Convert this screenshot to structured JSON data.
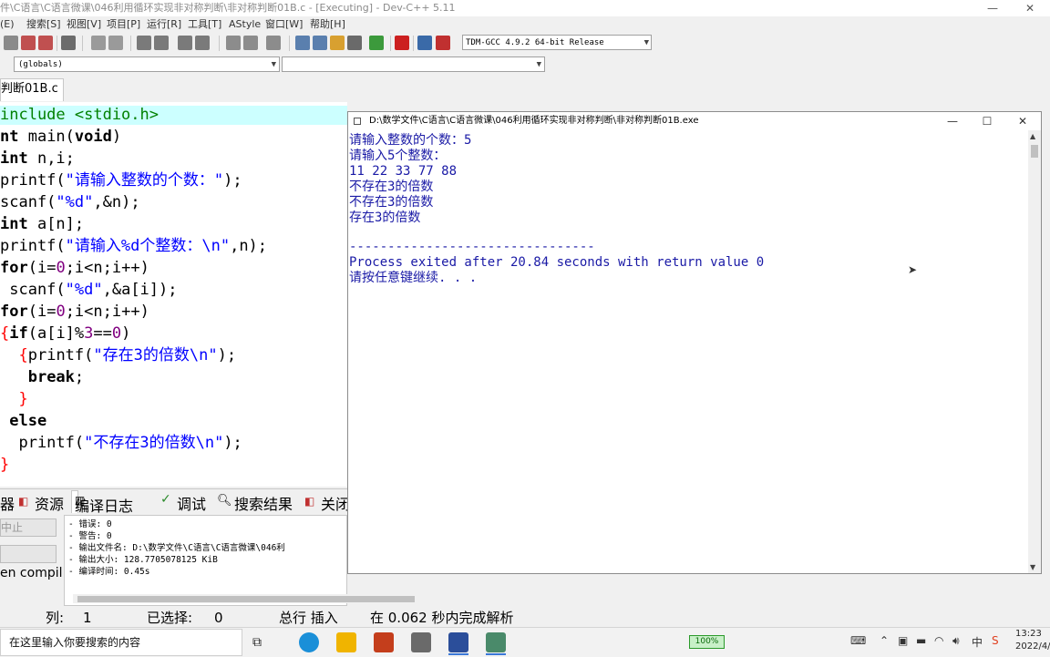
{
  "window": {
    "title": "件\\C语言\\C语言微课\\046利用循环实现非对称判断\\非对称判断01B.c - [Executing] - Dev-C++ 5.11",
    "minimize": "—",
    "maximize": "☐",
    "close": "✕"
  },
  "menu": [
    "(E)",
    "搜索[S]",
    "视图[V]",
    "项目[P]",
    "运行[R]",
    "工具[T]",
    "AStyle",
    "窗口[W]",
    "帮助[H]"
  ],
  "toolbar": {
    "compiler": "TDM-GCC 4.9.2 64-bit Release"
  },
  "scope": {
    "globals": "(globals)",
    "members": ""
  },
  "file_tab": "判断01B.c",
  "code_lines": [
    "include <stdio.h>",
    "nt main(void)",
    "int n,i;",
    "printf(\"请输入整数的个数：\");",
    "scanf(\"%d\",&n);",
    "int a[n];",
    "printf(\"请输入%d个整数：\\n\",n);",
    "for(i=0;i<n;i++)",
    " scanf(\"%d\",&a[i]);",
    "for(i=0;i<n;i++)",
    "{if(a[i]%3==0)",
    "  {printf(\"存在3的倍数\\n\");",
    "   break;",
    "  }",
    " else",
    "  printf(\"不存在3的倍数\\n\");",
    "}"
  ],
  "bottom_tabs": [
    "器",
    "资源",
    "编译日志",
    "调试",
    "搜索结果",
    "关闭"
  ],
  "left_buttons": [
    "中止",
    "",
    "en compil"
  ],
  "compile_log": [
    "- 错误: 0",
    "- 警告: 0",
    "- 输出文件名: D:\\数学文件\\C语言\\C语言微课\\046利",
    "- 输出大小: 128.7705078125 KiB",
    "- 编译时间: 0.45s"
  ],
  "status": {
    "col_label": "列:",
    "col_value": "1",
    "sel_label": "已选择:",
    "sel_value": "0",
    "mode": "总行  插入",
    "message": "在 0.062 秒内完成解析"
  },
  "console": {
    "title": "D:\\数学文件\\C语言\\C语言微课\\046利用循环实现非对称判断\\非对称判断01B.exe",
    "lines": [
      "请输入整数的个数：5",
      "请输入5个整数：",
      "11 22 33 77 88",
      "不存在3的倍数",
      "不存在3的倍数",
      "存在3的倍数",
      "",
      "--------------------------------",
      "Process exited after 20.84 seconds with return value 0",
      "请按任意键继续. . ."
    ]
  },
  "taskbar": {
    "search_placeholder": "在这里输入你要搜索的内容",
    "battery": "100%",
    "ime": "中",
    "time": "13:23",
    "date": "2022/4/"
  },
  "colors": {
    "editor_highlight": "#ccffff",
    "string": "#0000ff",
    "number": "#800080",
    "console_text": "#1a1aa6"
  }
}
